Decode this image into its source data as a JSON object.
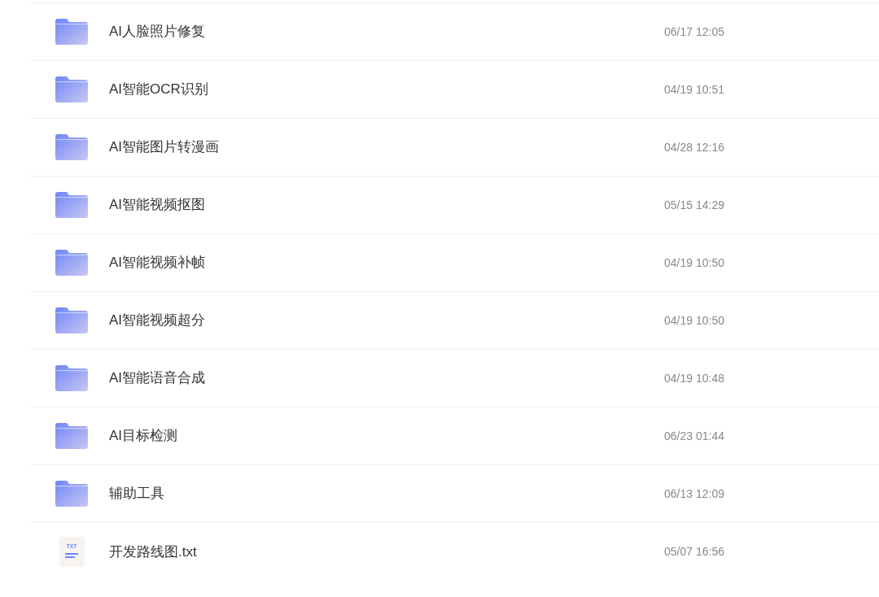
{
  "files": [
    {
      "kind": "folder",
      "name": "AI人脸照片修复",
      "modified": "06/17 12:05"
    },
    {
      "kind": "folder",
      "name": "AI智能OCR识别",
      "modified": "04/19 10:51"
    },
    {
      "kind": "folder",
      "name": "AI智能图片转漫画",
      "modified": "04/28 12:16"
    },
    {
      "kind": "folder",
      "name": "AI智能视频抠图",
      "modified": "05/15 14:29"
    },
    {
      "kind": "folder",
      "name": "AI智能视频补帧",
      "modified": "04/19 10:50"
    },
    {
      "kind": "folder",
      "name": "AI智能视频超分",
      "modified": "04/19 10:50"
    },
    {
      "kind": "folder",
      "name": "AI智能语音合成",
      "modified": "04/19 10:48"
    },
    {
      "kind": "folder",
      "name": "AI目标检测",
      "modified": "06/23 01:44"
    },
    {
      "kind": "folder",
      "name": "辅助工具",
      "modified": "06/13 12:09"
    },
    {
      "kind": "text-file",
      "badge": "TXT",
      "name": "开发路线图.txt",
      "modified": "05/07 16:56"
    }
  ]
}
